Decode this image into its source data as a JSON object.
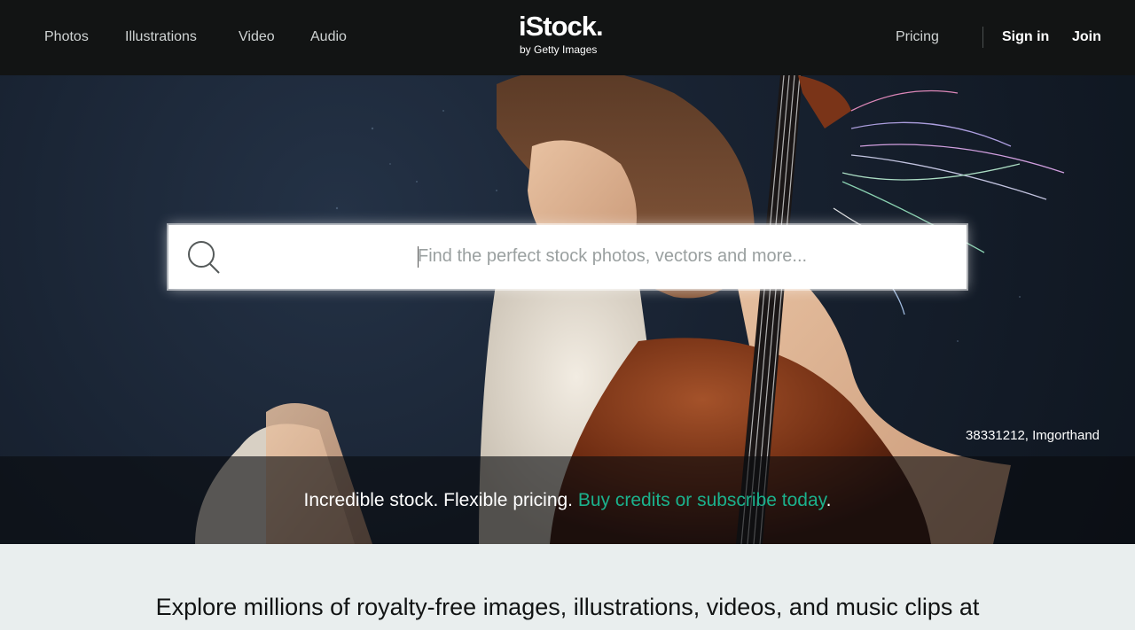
{
  "nav": {
    "left": [
      "Photos",
      "Illustrations",
      "Video",
      "Audio"
    ],
    "pricing": "Pricing",
    "sign_in": "Sign in",
    "join": "Join"
  },
  "logo": {
    "name": "iStock.",
    "sub": "by Getty Images"
  },
  "search": {
    "placeholder": "Find the perfect stock photos, vectors and more...",
    "value": "",
    "icon": "search-icon"
  },
  "hero": {
    "credit": "38331212, Imgorthand"
  },
  "promo": {
    "text": "Incredible stock. Flexible pricing. ",
    "link": "Buy credits or subscribe today",
    "tail": "."
  },
  "explore": {
    "text": "Explore millions of royalty-free images, illustrations, videos, and music clips at"
  },
  "colors": {
    "nav_bg": "#121414",
    "accent": "#1bb18c",
    "page_bg": "#e9eeee"
  }
}
